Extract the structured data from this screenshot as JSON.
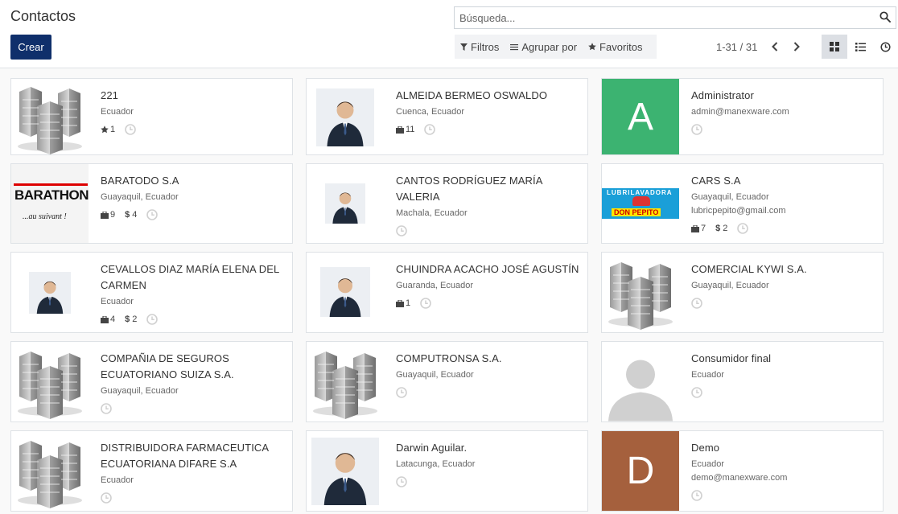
{
  "title": "Contactos",
  "create_label": "Crear",
  "search": {
    "placeholder": "Búsqueda..."
  },
  "filters": {
    "filters_label": "Filtros",
    "group_label": "Agrupar por",
    "favorites_label": "Favoritos"
  },
  "pager": {
    "value": "1-31 / 31"
  },
  "colors": {
    "brand": "#0f2f6b",
    "avatar_a": "#3cb371",
    "avatar_d": "#a5603d"
  },
  "cards": [
    {
      "title": "221",
      "subtitle": "Ecuador",
      "img": "building-icon",
      "meta": [
        {
          "icon": "star-icon",
          "value": "1"
        }
      ]
    },
    {
      "title": "ALMEIDA BERMEO OSWALDO",
      "subtitle": "Cuenca, Ecuador",
      "img": "person-photo",
      "meta": [
        {
          "icon": "briefcase-icon",
          "value": "11"
        }
      ]
    },
    {
      "title": "Administrator",
      "subtitle": "admin@manexware.com",
      "avatar_letter": "A",
      "meta": []
    },
    {
      "title": "BARATODO S.A",
      "subtitle": "Guayaquil, Ecuador",
      "logo_text": "BARATHON",
      "logo_tagline": "...au suivant !",
      "meta": [
        {
          "icon": "briefcase-icon",
          "value": "9"
        },
        {
          "icon": "dollar-icon",
          "value": "4"
        }
      ]
    },
    {
      "title": "CANTOS RODRÍGUEZ MARÍA VALERIA",
      "subtitle": "Machala, Ecuador",
      "img": "person-photo",
      "meta": []
    },
    {
      "title": "CARS S.A",
      "subtitle": "Guayaquil, Ecuador",
      "email": "lubricpepito@gmail.com",
      "logo_text": "LUBRILAVADORA",
      "logo_tagline": "DON PEPITO",
      "meta": [
        {
          "icon": "briefcase-icon",
          "value": "7"
        },
        {
          "icon": "dollar-icon",
          "value": "2"
        }
      ]
    },
    {
      "title": "CEVALLOS DIAZ MARÍA ELENA DEL CARMEN",
      "subtitle": "Ecuador",
      "img": "person-photo",
      "meta": [
        {
          "icon": "briefcase-icon",
          "value": "4"
        },
        {
          "icon": "dollar-icon",
          "value": "2"
        }
      ]
    },
    {
      "title": "CHUINDRA ACACHO JOSÉ AGUSTÍN",
      "subtitle": "Guaranda, Ecuador",
      "img": "person-photo",
      "meta": [
        {
          "icon": "briefcase-icon",
          "value": "1"
        }
      ]
    },
    {
      "title": "COMERCIAL KYWI S.A.",
      "subtitle": "Guayaquil, Ecuador",
      "img": "building-icon",
      "meta": []
    },
    {
      "title": "COMPAÑIA DE SEGUROS ECUATORIANO SUIZA S.A.",
      "subtitle": "Guayaquil, Ecuador",
      "img": "building-icon",
      "meta": []
    },
    {
      "title": "COMPUTRONSA S.A.",
      "subtitle": "Guayaquil, Ecuador",
      "img": "building-icon",
      "meta": []
    },
    {
      "title": "Consumidor final",
      "subtitle": "Ecuador",
      "img": "placeholder-person-icon",
      "meta": []
    },
    {
      "title": "DISTRIBUIDORA FARMACEUTICA ECUATORIANA DIFARE S.A",
      "subtitle": "Ecuador",
      "img": "building-icon",
      "meta": []
    },
    {
      "title": "Darwin Aguilar.",
      "subtitle": "Latacunga, Ecuador",
      "img": "person-photo",
      "meta": []
    },
    {
      "title": "Demo",
      "subtitle": "Ecuador",
      "email": "demo@manexware.com",
      "avatar_letter": "D",
      "meta": []
    }
  ]
}
